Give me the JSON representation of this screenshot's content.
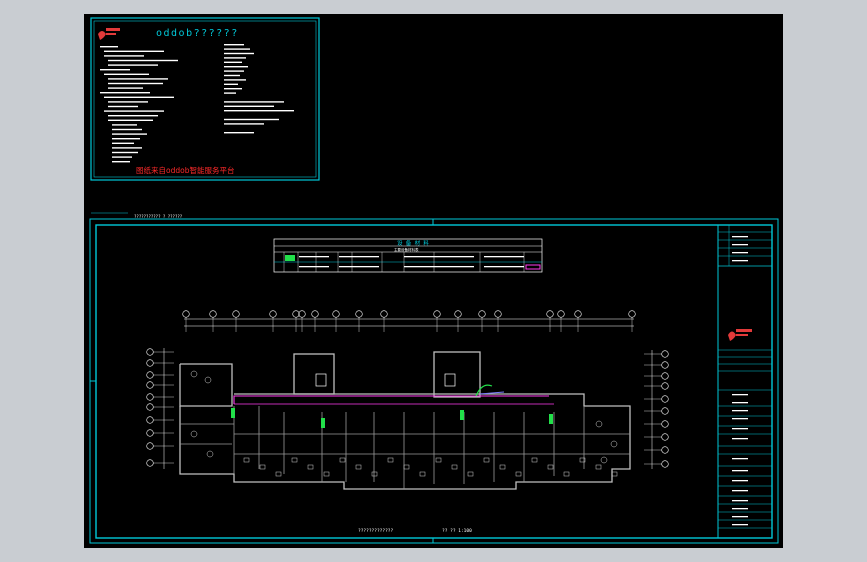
{
  "window": {
    "title": ""
  },
  "notes_sheet": {
    "heading": "oddob??????",
    "footer_notice": "图纸来自oddob智能服务平台",
    "logo_text": "oddob"
  },
  "main_sheet": {
    "header_strip": "??????????? ? ??????",
    "table": {
      "title": "设 备 材 料",
      "subtitle": "主要设备材料表",
      "row1": [
        "1",
        "?",
        "??????",
        "???? ?????????",
        "??? ?? ????",
        "????????"
      ],
      "row2": [
        "2",
        "?",
        "??????",
        "???? ?????????",
        "??? ?? ????",
        "????????"
      ]
    },
    "plan_caption": "?????????????",
    "plan_scale": "?? ?? 1:100",
    "dim_labels": [
      "?",
      "??",
      "?",
      "?",
      "??",
      "?",
      "?",
      "?",
      "?"
    ],
    "grid_axes_top": [
      "1",
      "2",
      "3",
      "4",
      "5",
      "6",
      "7",
      "8",
      "9",
      "10",
      "11",
      "12",
      "13",
      "14",
      "15",
      "16",
      "17"
    ],
    "grid_axes_left": [
      "A",
      "B",
      "C",
      "D",
      "E",
      "F",
      "G",
      "H"
    ],
    "title_block_logo": "oddob"
  },
  "colors": {
    "background": "#000000",
    "border": "#00c8d8",
    "notice_red": "#ff2a2a",
    "pipe_magenta": "#ff3cf0",
    "fixture_green": "#22e04a",
    "text_white": "#ffffff"
  }
}
